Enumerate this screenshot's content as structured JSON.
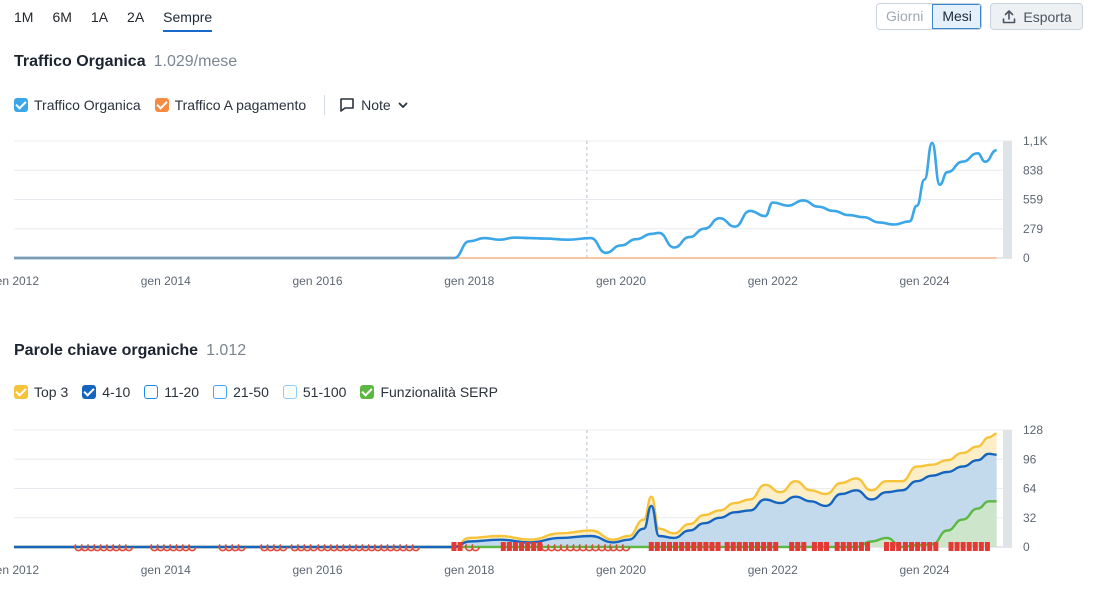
{
  "periods": [
    "1M",
    "6M",
    "1A",
    "2A",
    "Sempre"
  ],
  "active_period": "Sempre",
  "granularity": {
    "options": [
      "Giorni",
      "Mesi"
    ],
    "selected": "Mesi"
  },
  "export_label": "Esporta",
  "traffic": {
    "title": "Traffico Organica",
    "value": "1.029/mese",
    "legend": [
      {
        "label": "Traffico Organica",
        "color": "#3ba6e8",
        "checked": true
      },
      {
        "label": "Traffico A pagamento",
        "color": "#f58a42",
        "checked": true
      }
    ],
    "notes_label": "Note"
  },
  "keywords": {
    "title": "Parole chiave organiche",
    "value": "1.012",
    "legend": [
      {
        "label": "Top 3",
        "color": "#f7c33b",
        "checked": true
      },
      {
        "label": "4-10",
        "color": "#1565c0",
        "checked": true
      },
      {
        "label": "11-20",
        "color": "#1e88e5",
        "checked": false
      },
      {
        "label": "21-50",
        "color": "#42a5f5",
        "checked": false
      },
      {
        "label": "51-100",
        "color": "#90caf9",
        "checked": false
      },
      {
        "label": "Funzionalità SERP",
        "color": "#5db843",
        "checked": true
      }
    ]
  },
  "chart_data": [
    {
      "type": "line",
      "title": "Traffico Organica",
      "x_tick_labels": [
        "gen 2012",
        "gen 2014",
        "gen 2016",
        "gen 2018",
        "gen 2020",
        "gen 2022",
        "gen 2024"
      ],
      "y_tick_labels": [
        "1,1K",
        "838",
        "559",
        "279",
        "0"
      ],
      "ylim": [
        0,
        1118
      ],
      "grid": true,
      "x": [
        2012.0,
        2017.8,
        2018.0,
        2018.2,
        2018.4,
        2018.6,
        2018.8,
        2019.0,
        2019.3,
        2019.6,
        2019.8,
        2020.0,
        2020.2,
        2020.4,
        2020.5,
        2020.7,
        2020.9,
        2021.1,
        2021.3,
        2021.5,
        2021.7,
        2021.9,
        2022.0,
        2022.2,
        2022.4,
        2022.6,
        2022.8,
        2023.0,
        2023.2,
        2023.4,
        2023.6,
        2023.8,
        2023.9,
        2024.0,
        2024.1,
        2024.2,
        2024.3,
        2024.5,
        2024.7,
        2024.8,
        2024.95
      ],
      "series": [
        {
          "name": "Traffico Organica",
          "values": [
            0,
            0,
            160,
            190,
            175,
            195,
            190,
            185,
            175,
            190,
            50,
            120,
            180,
            230,
            240,
            100,
            200,
            280,
            380,
            300,
            450,
            400,
            530,
            500,
            550,
            490,
            450,
            410,
            390,
            340,
            320,
            350,
            500,
            750,
            1100,
            700,
            820,
            920,
            1000,
            920,
            1030
          ]
        },
        {
          "name": "Traffico A pagamento",
          "values": [
            0,
            0,
            0,
            0,
            0,
            0,
            0,
            0,
            0,
            0,
            0,
            0,
            0,
            0,
            0,
            0,
            0,
            0,
            0,
            0,
            0,
            0,
            0,
            0,
            0,
            0,
            0,
            0,
            0,
            0,
            0,
            0,
            0,
            0,
            0,
            0,
            0,
            0,
            0,
            0,
            0
          ]
        }
      ]
    },
    {
      "type": "area",
      "title": "Parole chiave organiche",
      "x_tick_labels": [
        "gen 2012",
        "gen 2014",
        "gen 2016",
        "gen 2018",
        "gen 2020",
        "gen 2022",
        "gen 2024"
      ],
      "y_tick_labels": [
        "128",
        "96",
        "64",
        "32",
        "0"
      ],
      "ylim": [
        0,
        128
      ],
      "grid": true,
      "x": [
        2012.0,
        2017.8,
        2018.0,
        2018.4,
        2018.8,
        2019.2,
        2019.6,
        2019.9,
        2020.1,
        2020.3,
        2020.4,
        2020.5,
        2020.7,
        2020.9,
        2021.1,
        2021.3,
        2021.5,
        2021.7,
        2021.9,
        2022.1,
        2022.3,
        2022.5,
        2022.7,
        2022.9,
        2023.1,
        2023.3,
        2023.5,
        2023.7,
        2023.9,
        2024.1,
        2024.3,
        2024.5,
        2024.7,
        2024.85,
        2024.95
      ],
      "series": [
        {
          "name": "Top 3",
          "values": [
            0,
            0,
            10,
            12,
            8,
            15,
            18,
            8,
            12,
            30,
            55,
            20,
            15,
            25,
            35,
            40,
            48,
            52,
            68,
            60,
            72,
            62,
            58,
            70,
            75,
            62,
            72,
            72,
            88,
            90,
            95,
            103,
            110,
            120,
            124
          ]
        },
        {
          "name": "4-10",
          "values": [
            0,
            0,
            6,
            8,
            5,
            10,
            12,
            5,
            8,
            20,
            45,
            12,
            10,
            18,
            26,
            32,
            38,
            40,
            52,
            48,
            55,
            50,
            45,
            58,
            62,
            52,
            60,
            62,
            72,
            78,
            82,
            88,
            95,
            102,
            101
          ]
        },
        {
          "name": "Funzionalità SERP",
          "values": [
            0,
            0,
            0,
            0,
            0,
            0,
            0,
            0,
            0,
            0,
            0,
            0,
            0,
            0,
            0,
            0,
            0,
            0,
            0,
            0,
            0,
            0,
            0,
            0,
            0,
            6,
            10,
            0,
            2,
            3,
            18,
            30,
            42,
            50,
            50
          ]
        }
      ]
    }
  ]
}
